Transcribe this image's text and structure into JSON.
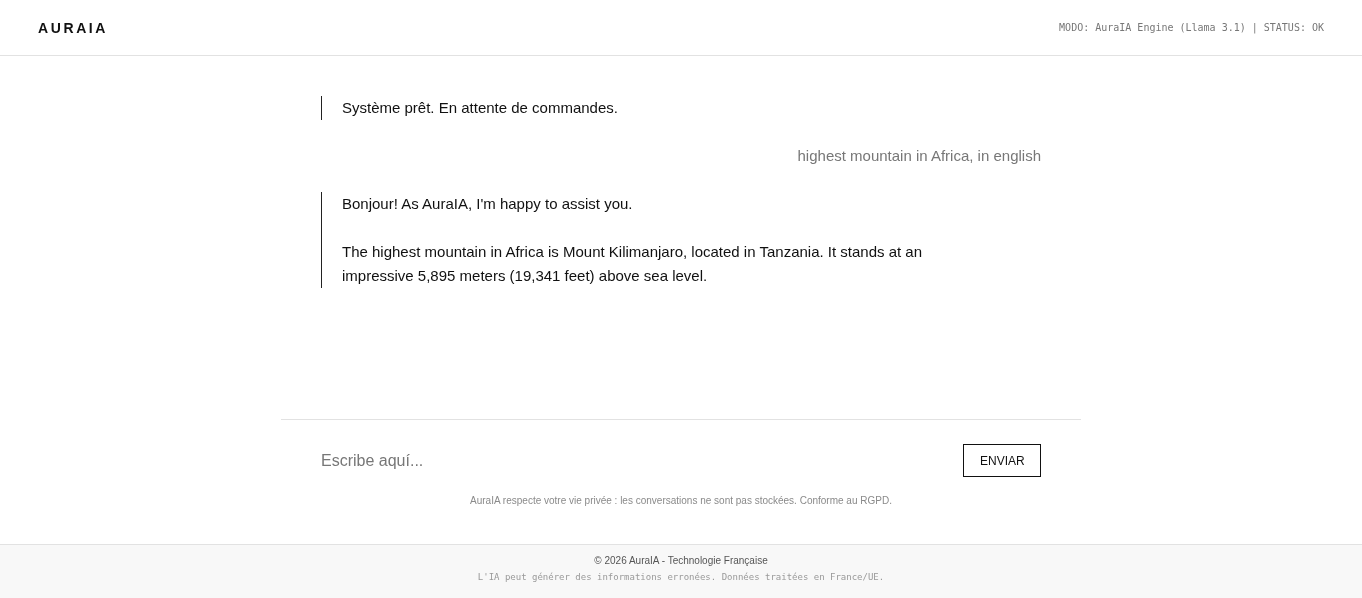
{
  "header": {
    "logo": "AURAIA",
    "status": "MODO: AuraIA Engine (Llama 3.1) | STATUS: OK"
  },
  "messages": [
    {
      "kind": "assistant",
      "paragraphs": [
        "Système prêt. En attente de commandes."
      ]
    },
    {
      "kind": "user",
      "paragraphs": [
        "highest mountain in Africa, in english"
      ]
    },
    {
      "kind": "assistant",
      "paragraphs": [
        "Bonjour! As AuraIA, I'm happy to assist you.",
        "The highest mountain in Africa is Mount Kilimanjaro, located in Tanzania. It stands at an impressive 5,895 meters (19,341 feet) above sea level."
      ]
    }
  ],
  "composer": {
    "placeholder": "Escribe aquí...",
    "send_button": "ENVIAR",
    "privacy_note": "AuraIA respecte votre vie privée : les conversations ne sont pas stockées. Conforme au RGPD."
  },
  "footer": {
    "copyright": "© 2026 AuraIA - Technologie Française",
    "disclaimer": "L'IA peut générer des informations erronées. Données traitées en France/UE."
  }
}
